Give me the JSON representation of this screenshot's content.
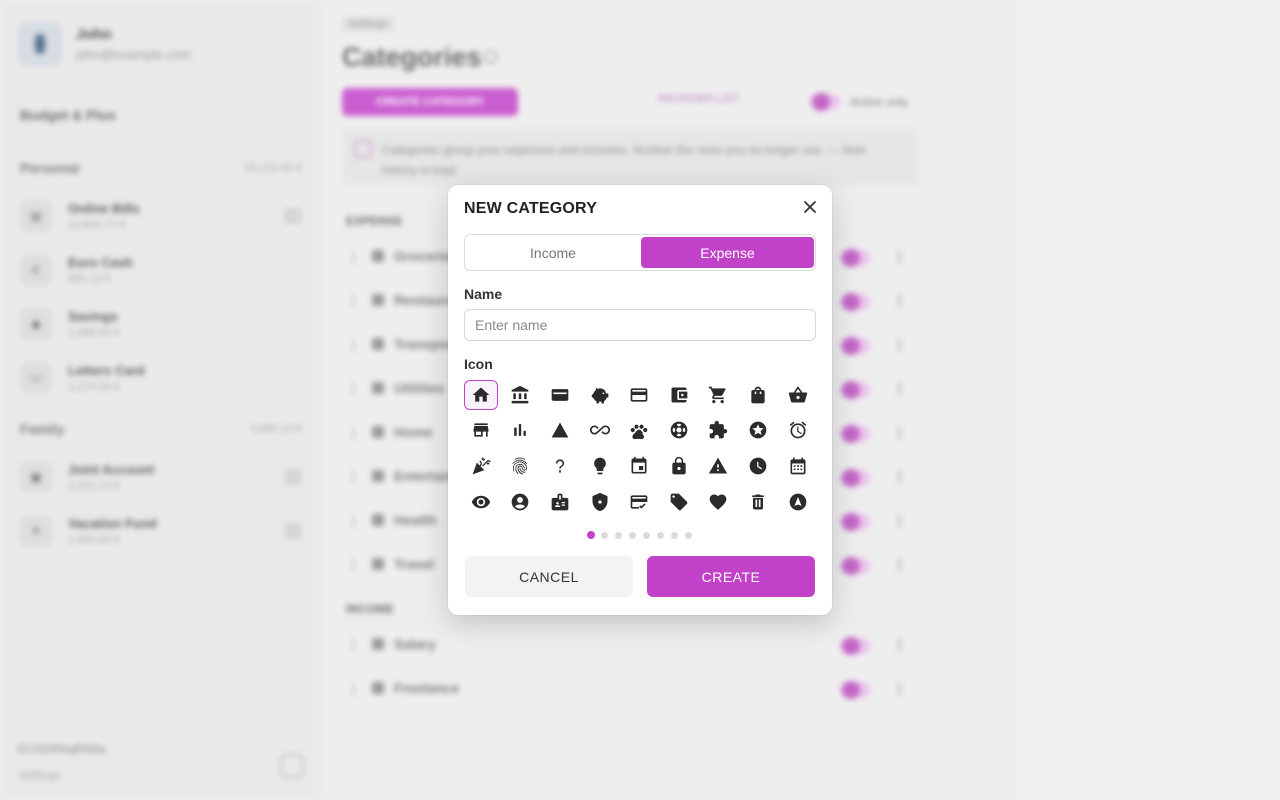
{
  "colors": {
    "accent": "#c142c8",
    "background": "#ececec"
  },
  "sidebar": {
    "user": {
      "name": "John",
      "email": "john@example.com"
    },
    "title": "Budget & Plus",
    "sections": [
      {
        "title": "Personal",
        "amount": "15,123.00 €",
        "accounts": [
          {
            "name": "Online Bills",
            "value": "13,800.77 €"
          },
          {
            "name": "Euro Cash",
            "value": "855.13 €"
          },
          {
            "name": "Savings",
            "value": "1,088.00 €"
          },
          {
            "name": "Letters Card",
            "value": "1,270.00 €"
          }
        ]
      },
      {
        "title": "Family",
        "amount": "3,695.13 €",
        "accounts": [
          {
            "name": "Joint Account",
            "value": "2,231.13 €"
          },
          {
            "name": "Vacation Fund",
            "value": "1,464.00 €"
          }
        ]
      }
    ],
    "footer": {
      "line1": "ECGDRbqlRb6a",
      "line2": "Settings"
    }
  },
  "main": {
    "breadcrumb": "Settings",
    "title": "Categories",
    "new_button": "CREATE CATEGORY",
    "reorder": "REORDER LIST",
    "active_only": "Active only",
    "info": "Categories group your expenses and incomes. Archive the ones you no longer use. — their history is kept.",
    "expense_group": "EXPENSE",
    "expense_rows": [
      "Groceries",
      "Restaurants",
      "Transport",
      "Utilities",
      "Home",
      "Entertainment",
      "Health",
      "Travel"
    ],
    "income_group": "INCOME",
    "income_rows": [
      "Salary",
      "Freelance"
    ]
  },
  "dialog": {
    "title": "NEW CATEGORY",
    "close_icon": "close-icon",
    "tabs": {
      "income": "Income",
      "expense": "Expense",
      "selected": "expense"
    },
    "name_label": "Name",
    "name_placeholder": "Enter name",
    "name_value": "",
    "icon_label": "Icon",
    "icons": [
      "home-icon",
      "bank-icon",
      "wallet-icon",
      "piggy-bank-icon",
      "credit-card-icon",
      "account-balance-wallet-icon",
      "shopping-cart-icon",
      "shopping-bag-icon",
      "shopping-basket-icon",
      "store-icon",
      "bar-chart-icon",
      "triangle-icon",
      "infinity-icon",
      "paw-icon",
      "lifebuoy-icon",
      "puzzle-icon",
      "star-circle-icon",
      "alarm-icon",
      "celebration-icon",
      "fingerprint-icon",
      "question-mark-icon",
      "lightbulb-icon",
      "event-icon",
      "lock-icon",
      "warning-icon",
      "clock-icon",
      "calendar-icon",
      "eye-icon",
      "account-circle-icon",
      "badge-icon",
      "shield-icon",
      "card-check-icon",
      "tag-icon",
      "heart-icon",
      "trash-icon",
      "navigation-icon"
    ],
    "selected_icon": "home-icon",
    "pages": 8,
    "current_page": 1,
    "cancel": "CANCEL",
    "create": "CREATE"
  }
}
